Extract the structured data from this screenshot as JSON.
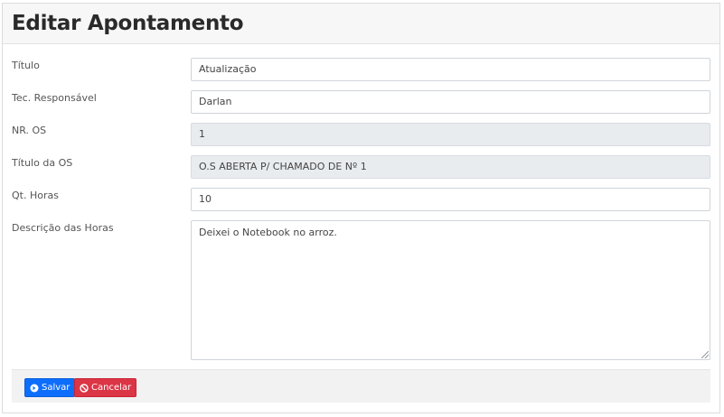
{
  "header": {
    "title": "Editar Apontamento"
  },
  "form": {
    "titulo": {
      "label": "Título",
      "value": "Atualização"
    },
    "tecnico": {
      "label": "Tec. Responsável",
      "value": "Darlan"
    },
    "nr_os": {
      "label": "NR. OS",
      "value": "1"
    },
    "titulo_os": {
      "label": "Título da OS",
      "value": "O.S ABERTA P/ CHAMADO DE Nº 1"
    },
    "qt_horas": {
      "label": "Qt. Horas",
      "value": "10"
    },
    "descricao": {
      "label": "Descrição das Horas",
      "value": "Deixei o Notebook no arroz."
    }
  },
  "footer": {
    "save_label": "Salvar",
    "cancel_label": "Cancelar",
    "save_icon": "arrow-circle-right-icon",
    "cancel_icon": "ban-icon"
  },
  "colors": {
    "primary": "#0d6efd",
    "danger": "#dc3545",
    "readonly_bg": "#e9ecef"
  }
}
